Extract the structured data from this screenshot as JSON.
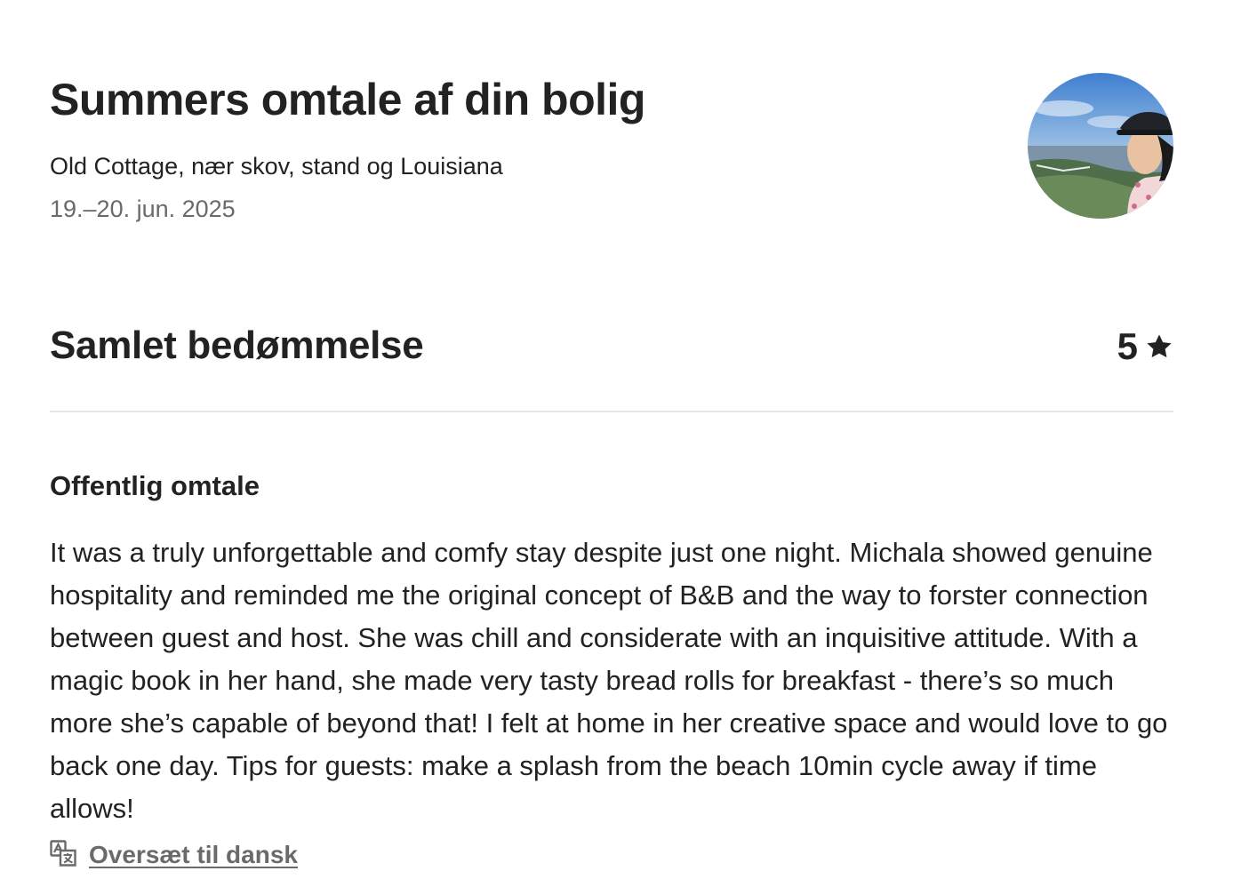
{
  "header": {
    "title": "Summers omtale af din bolig",
    "listing_name": "Old Cottage, nær skov, stand og Louisiana",
    "dates": "19.–20. jun. 2025",
    "avatar_icon": "user-photo"
  },
  "overall_rating": {
    "label": "Samlet bedømmelse",
    "value": "5",
    "icon": "star-icon"
  },
  "public_review": {
    "heading": "Offentlig omtale",
    "text": "It was a truly unforgettable and comfy stay despite just one night. Michala showed genuine hospitality and reminded me the original concept of B&B and the way to forster connection between guest and host. She was chill and considerate with an inquisitive attitude. With a magic book in her hand, she made very tasty bread rolls for breakfast - there’s so much more she’s capable of beyond that! I felt at home in her creative space and would love to go back one day. Tips for guests: make a splash from the beach 10min cycle away if time allows!",
    "translate_label": "Oversæt til dansk",
    "translate_icon": "translate-icon"
  },
  "colors": {
    "text_primary": "#222222",
    "text_secondary": "#6a6a6a",
    "divider": "#e5e5e5"
  }
}
